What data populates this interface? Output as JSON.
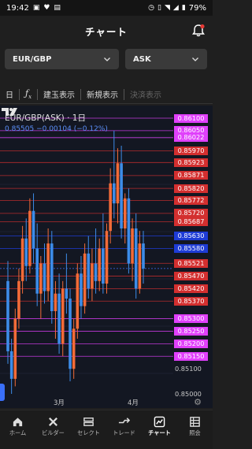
{
  "status": {
    "time": "19:42",
    "battery": "79%"
  },
  "header": {
    "title": "チャート"
  },
  "selectors": {
    "pair": "EUR/GBP",
    "side": "ASK"
  },
  "toolbar": {
    "items": [
      {
        "label": "日",
        "enabled": true
      },
      {
        "label": "fx",
        "enabled": true
      },
      {
        "label": "建玉表示",
        "enabled": true
      },
      {
        "label": "新規表示",
        "enabled": true
      },
      {
        "label": "決済表示",
        "enabled": false
      }
    ]
  },
  "chart": {
    "legend_title": "EUR/GBP(ASK) · 1日",
    "legend_values": "0.85505  −0.00104 (−0.12%)",
    "x_labels": [
      "3月",
      "4月"
    ]
  },
  "chart_data": {
    "type": "candlestick",
    "title": "EUR/GBP(ASK) · 1日",
    "y_range": [
      0.8495,
      0.8613
    ],
    "price_labels": [
      {
        "value": "0.86100",
        "color": "#e040fb"
      },
      {
        "value": "0.86050",
        "color": "#e040fb"
      },
      {
        "value": "0.86022",
        "color": "#e040fb"
      },
      {
        "value": "0.85970",
        "color": "#d32f2f"
      },
      {
        "value": "0.85923",
        "color": "#d32f2f"
      },
      {
        "value": "0.85871",
        "color": "#d32f2f"
      },
      {
        "value": "0.85820",
        "color": "#d32f2f"
      },
      {
        "value": "0.85772",
        "color": "#d32f2f"
      },
      {
        "value": "0.85720",
        "color": "#d32f2f"
      },
      {
        "value": "0.85687",
        "color": "#d32f2f"
      },
      {
        "value": "0.85630",
        "color": "#1e3cd6"
      },
      {
        "value": "0.85580",
        "color": "#1e3cd6"
      },
      {
        "value": "0.85521",
        "color": "#d32f2f"
      },
      {
        "value": "0.85470",
        "color": "#d32f2f"
      },
      {
        "value": "0.85420",
        "color": "#d32f2f"
      },
      {
        "value": "0.85370",
        "color": "#d32f2f"
      },
      {
        "value": "0.85300",
        "color": "#e040fb"
      },
      {
        "value": "0.85250",
        "color": "#e040fb"
      },
      {
        "value": "0.85200",
        "color": "#e040fb"
      },
      {
        "value": "0.85150",
        "color": "#e040fb"
      }
    ],
    "plain_axis_labels": [
      "0.85100",
      "0.85000"
    ],
    "candles": [
      {
        "o": 0.8545,
        "h": 0.8553,
        "l": 0.8512,
        "c": 0.8517
      },
      {
        "o": 0.8517,
        "h": 0.8522,
        "l": 0.85,
        "c": 0.8506
      },
      {
        "o": 0.8506,
        "h": 0.8534,
        "l": 0.8503,
        "c": 0.853
      },
      {
        "o": 0.853,
        "h": 0.855,
        "l": 0.8526,
        "c": 0.8545
      },
      {
        "o": 0.8545,
        "h": 0.8567,
        "l": 0.854,
        "c": 0.8562
      },
      {
        "o": 0.8562,
        "h": 0.857,
        "l": 0.8545,
        "c": 0.8551
      },
      {
        "o": 0.8551,
        "h": 0.8578,
        "l": 0.8548,
        "c": 0.8573
      },
      {
        "o": 0.8573,
        "h": 0.858,
        "l": 0.8552,
        "c": 0.8558
      },
      {
        "o": 0.8558,
        "h": 0.8568,
        "l": 0.8535,
        "c": 0.854
      },
      {
        "o": 0.854,
        "h": 0.8555,
        "l": 0.853,
        "c": 0.8552
      },
      {
        "o": 0.8552,
        "h": 0.856,
        "l": 0.8536,
        "c": 0.8541
      },
      {
        "o": 0.8541,
        "h": 0.8566,
        "l": 0.8537,
        "c": 0.856
      },
      {
        "o": 0.856,
        "h": 0.8565,
        "l": 0.8528,
        "c": 0.8533
      },
      {
        "o": 0.8533,
        "h": 0.8545,
        "l": 0.8522,
        "c": 0.854
      },
      {
        "o": 0.854,
        "h": 0.8548,
        "l": 0.8516,
        "c": 0.852
      },
      {
        "o": 0.852,
        "h": 0.8545,
        "l": 0.8515,
        "c": 0.8542
      },
      {
        "o": 0.8542,
        "h": 0.8556,
        "l": 0.8532,
        "c": 0.8538
      },
      {
        "o": 0.8538,
        "h": 0.8542,
        "l": 0.8505,
        "c": 0.851
      },
      {
        "o": 0.851,
        "h": 0.853,
        "l": 0.8506,
        "c": 0.8526
      },
      {
        "o": 0.8526,
        "h": 0.8552,
        "l": 0.8522,
        "c": 0.8548
      },
      {
        "o": 0.8548,
        "h": 0.8555,
        "l": 0.853,
        "c": 0.8535
      },
      {
        "o": 0.8535,
        "h": 0.856,
        "l": 0.8532,
        "c": 0.8556
      },
      {
        "o": 0.8556,
        "h": 0.8563,
        "l": 0.8538,
        "c": 0.8542
      },
      {
        "o": 0.8542,
        "h": 0.8558,
        "l": 0.8537,
        "c": 0.8552
      },
      {
        "o": 0.8552,
        "h": 0.8566,
        "l": 0.854,
        "c": 0.8545
      },
      {
        "o": 0.8545,
        "h": 0.8562,
        "l": 0.8541,
        "c": 0.8558
      },
      {
        "o": 0.8558,
        "h": 0.8572,
        "l": 0.854,
        "c": 0.8544
      },
      {
        "o": 0.8544,
        "h": 0.8568,
        "l": 0.854,
        "c": 0.8565
      },
      {
        "o": 0.8565,
        "h": 0.859,
        "l": 0.856,
        "c": 0.8584
      },
      {
        "o": 0.8584,
        "h": 0.8605,
        "l": 0.857,
        "c": 0.8576
      },
      {
        "o": 0.8576,
        "h": 0.8598,
        "l": 0.8568,
        "c": 0.8592
      },
      {
        "o": 0.8592,
        "h": 0.8599,
        "l": 0.8562,
        "c": 0.8566
      },
      {
        "o": 0.8566,
        "h": 0.858,
        "l": 0.856,
        "c": 0.8578
      },
      {
        "o": 0.8578,
        "h": 0.8582,
        "l": 0.8548,
        "c": 0.8552
      },
      {
        "o": 0.8552,
        "h": 0.857,
        "l": 0.8545,
        "c": 0.8566
      },
      {
        "o": 0.8566,
        "h": 0.8572,
        "l": 0.8538,
        "c": 0.8542
      },
      {
        "o": 0.8542,
        "h": 0.8565,
        "l": 0.854,
        "c": 0.856
      },
      {
        "o": 0.856,
        "h": 0.8565,
        "l": 0.8544,
        "c": 0.855
      }
    ]
  },
  "nav": {
    "items": [
      {
        "label": "ホーム",
        "icon": "home-icon",
        "active": false
      },
      {
        "label": "ビルダー",
        "icon": "tools-icon",
        "active": false
      },
      {
        "label": "セレクト",
        "icon": "select-icon",
        "active": false
      },
      {
        "label": "トレード",
        "icon": "trade-icon",
        "active": false
      },
      {
        "label": "チャート",
        "icon": "chart-icon",
        "active": true
      },
      {
        "label": "照会",
        "icon": "inquiry-icon",
        "active": false
      }
    ]
  }
}
